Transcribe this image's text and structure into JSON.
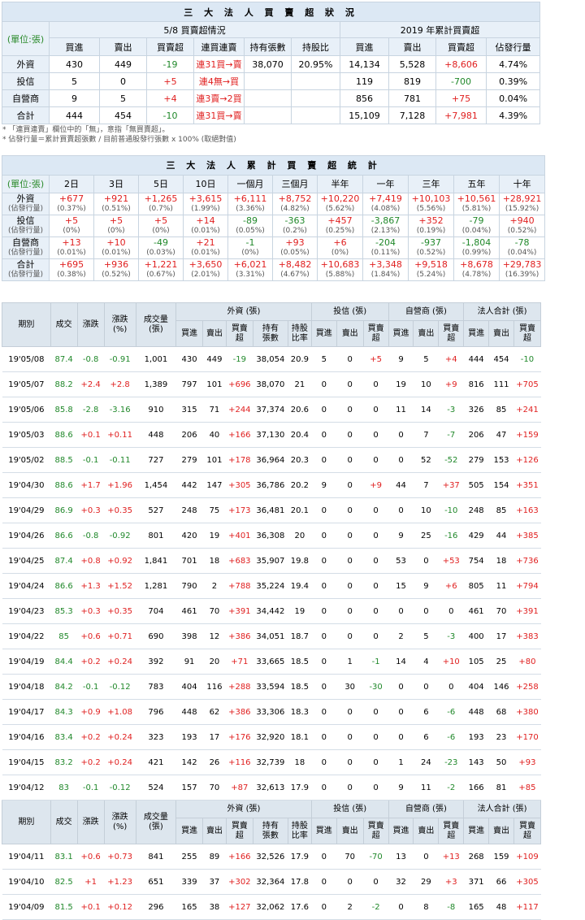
{
  "summary": {
    "title": "三 大 法 人 買 賣 超 狀 況",
    "unit": "(單位:張)",
    "daily_header": "5/8 買賣超情況",
    "ytd_header": "2019 年累計買賣超",
    "cols": [
      "買進",
      "賣出",
      "買賣超",
      "連買連賣",
      "持有張數",
      "持股比",
      "買進",
      "賣出",
      "買賣超",
      "佔發行量"
    ],
    "rows": [
      {
        "name": "外資",
        "buy": "430",
        "sell": "449",
        "net": "-19",
        "streak": "連31買→賣",
        "hold": "38,070",
        "ratio": "20.95%",
        "ybuy": "14,134",
        "ysell": "5,528",
        "ynet": "+8,606",
        "share": "4.74%"
      },
      {
        "name": "投信",
        "buy": "5",
        "sell": "0",
        "net": "+5",
        "streak": "連4無→買",
        "hold": "",
        "ratio": "",
        "ybuy": "119",
        "ysell": "819",
        "ynet": "-700",
        "share": "0.39%"
      },
      {
        "name": "自營商",
        "buy": "9",
        "sell": "5",
        "net": "+4",
        "streak": "連3賣→2買",
        "hold": "",
        "ratio": "",
        "ybuy": "856",
        "ysell": "781",
        "ynet": "+75",
        "share": "0.04%"
      },
      {
        "name": "合計",
        "buy": "444",
        "sell": "454",
        "net": "-10",
        "streak": "連31買→賣",
        "hold": "",
        "ratio": "",
        "ybuy": "15,109",
        "ysell": "7,128",
        "ynet": "+7,981",
        "share": "4.39%"
      }
    ],
    "notes": [
      "* 「連買連賣」欄位中的「無」，意指「無買賣超」。",
      "* 佔發行量＝累計買賣超張數 / 目前普通股發行張數 x 100% (取絕對值)"
    ]
  },
  "cumulative": {
    "title": "三 大 法 人 累 計 買 賣 超 統 計",
    "unit": "(單位:張)",
    "periods": [
      "2日",
      "3日",
      "5日",
      "10日",
      "一個月",
      "三個月",
      "半年",
      "一年",
      "三年",
      "五年",
      "十年"
    ],
    "sub_label": "(佔發行量)",
    "rows": [
      {
        "name": "外資",
        "vals": [
          "+677",
          "+921",
          "+1,265",
          "+3,615",
          "+6,111",
          "+8,752",
          "+10,220",
          "+7,419",
          "+10,103",
          "+10,561",
          "+28,921"
        ],
        "pcts": [
          "(0.37%)",
          "(0.51%)",
          "(0.7%)",
          "(1.99%)",
          "(3.36%)",
          "(4.82%)",
          "(5.62%)",
          "(4.08%)",
          "(5.56%)",
          "(5.81%)",
          "(15.92%)"
        ]
      },
      {
        "name": "投信",
        "vals": [
          "+5",
          "+5",
          "+5",
          "+14",
          "-89",
          "-363",
          "+457",
          "-3,867",
          "+352",
          "-79",
          "+940"
        ],
        "pcts": [
          "(0%)",
          "(0%)",
          "(0%)",
          "(0.01%)",
          "(0.05%)",
          "(0.2%)",
          "(0.25%)",
          "(2.13%)",
          "(0.19%)",
          "(0.04%)",
          "(0.52%)"
        ]
      },
      {
        "name": "自營商",
        "vals": [
          "+13",
          "+10",
          "-49",
          "+21",
          "-1",
          "+93",
          "+6",
          "-204",
          "-937",
          "-1,804",
          "-78"
        ],
        "pcts": [
          "(0.01%)",
          "(0.01%)",
          "(0.03%)",
          "(0.01%)",
          "(0%)",
          "(0.05%)",
          "(0%)",
          "(0.11%)",
          "(0.52%)",
          "(0.99%)",
          "(0.04%)"
        ]
      },
      {
        "name": "合計",
        "vals": [
          "+695",
          "+936",
          "+1,221",
          "+3,650",
          "+6,021",
          "+8,482",
          "+10,683",
          "+3,348",
          "+9,518",
          "+8,678",
          "+29,783"
        ],
        "pcts": [
          "(0.38%)",
          "(0.52%)",
          "(0.67%)",
          "(2.01%)",
          "(3.31%)",
          "(4.67%)",
          "(5.88%)",
          "(1.84%)",
          "(5.24%)",
          "(4.78%)",
          "(16.39%)"
        ]
      }
    ]
  },
  "history": {
    "headers": {
      "date": "期別",
      "close": "成交",
      "change": "漲跌",
      "pct": "漲跌\n(%)",
      "vol": "成交量\n(張)",
      "foreign": "外資 (張)",
      "trust": "投信 (張)",
      "dealer": "自營商 (張)",
      "total": "法人合計 (張)",
      "buy": "買進",
      "sell": "賣出",
      "net": "買賣\n超",
      "hold": "持有\n張數",
      "ratio": "持股\n比率"
    },
    "rows1": [
      [
        "19'05/08",
        "87.4",
        "-0.8",
        "-0.91",
        "1,001",
        "430",
        "449",
        "-19",
        "38,054",
        "20.9",
        "5",
        "0",
        "+5",
        "9",
        "5",
        "+4",
        "444",
        "454",
        "-10"
      ],
      [
        "19'05/07",
        "88.2",
        "+2.4",
        "+2.8",
        "1,389",
        "797",
        "101",
        "+696",
        "38,070",
        "21",
        "0",
        "0",
        "0",
        "19",
        "10",
        "+9",
        "816",
        "111",
        "+705"
      ],
      [
        "19'05/06",
        "85.8",
        "-2.8",
        "-3.16",
        "910",
        "315",
        "71",
        "+244",
        "37,374",
        "20.6",
        "0",
        "0",
        "0",
        "11",
        "14",
        "-3",
        "326",
        "85",
        "+241"
      ],
      [
        "19'05/03",
        "88.6",
        "+0.1",
        "+0.11",
        "448",
        "206",
        "40",
        "+166",
        "37,130",
        "20.4",
        "0",
        "0",
        "0",
        "0",
        "7",
        "-7",
        "206",
        "47",
        "+159"
      ],
      [
        "19'05/02",
        "88.5",
        "-0.1",
        "-0.11",
        "727",
        "279",
        "101",
        "+178",
        "36,964",
        "20.3",
        "0",
        "0",
        "0",
        "0",
        "52",
        "-52",
        "279",
        "153",
        "+126"
      ],
      [
        "19'04/30",
        "88.6",
        "+1.7",
        "+1.96",
        "1,454",
        "442",
        "147",
        "+305",
        "36,786",
        "20.2",
        "9",
        "0",
        "+9",
        "44",
        "7",
        "+37",
        "505",
        "154",
        "+351"
      ],
      [
        "19'04/29",
        "86.9",
        "+0.3",
        "+0.35",
        "527",
        "248",
        "75",
        "+173",
        "36,481",
        "20.1",
        "0",
        "0",
        "0",
        "0",
        "10",
        "-10",
        "248",
        "85",
        "+163"
      ],
      [
        "19'04/26",
        "86.6",
        "-0.8",
        "-0.92",
        "801",
        "420",
        "19",
        "+401",
        "36,308",
        "20",
        "0",
        "0",
        "0",
        "9",
        "25",
        "-16",
        "429",
        "44",
        "+385"
      ],
      [
        "19'04/25",
        "87.4",
        "+0.8",
        "+0.92",
        "1,841",
        "701",
        "18",
        "+683",
        "35,907",
        "19.8",
        "0",
        "0",
        "0",
        "53",
        "0",
        "+53",
        "754",
        "18",
        "+736"
      ],
      [
        "19'04/24",
        "86.6",
        "+1.3",
        "+1.52",
        "1,281",
        "790",
        "2",
        "+788",
        "35,224",
        "19.4",
        "0",
        "0",
        "0",
        "15",
        "9",
        "+6",
        "805",
        "11",
        "+794"
      ],
      [
        "19'04/23",
        "85.3",
        "+0.3",
        "+0.35",
        "704",
        "461",
        "70",
        "+391",
        "34,442",
        "19",
        "0",
        "0",
        "0",
        "0",
        "0",
        "0",
        "461",
        "70",
        "+391"
      ],
      [
        "19'04/22",
        "85",
        "+0.6",
        "+0.71",
        "690",
        "398",
        "12",
        "+386",
        "34,051",
        "18.7",
        "0",
        "0",
        "0",
        "2",
        "5",
        "-3",
        "400",
        "17",
        "+383"
      ],
      [
        "19'04/19",
        "84.4",
        "+0.2",
        "+0.24",
        "392",
        "91",
        "20",
        "+71",
        "33,665",
        "18.5",
        "0",
        "1",
        "-1",
        "14",
        "4",
        "+10",
        "105",
        "25",
        "+80"
      ],
      [
        "19'04/18",
        "84.2",
        "-0.1",
        "-0.12",
        "783",
        "404",
        "116",
        "+288",
        "33,594",
        "18.5",
        "0",
        "30",
        "-30",
        "0",
        "0",
        "0",
        "404",
        "146",
        "+258"
      ],
      [
        "19'04/17",
        "84.3",
        "+0.9",
        "+1.08",
        "796",
        "448",
        "62",
        "+386",
        "33,306",
        "18.3",
        "0",
        "0",
        "0",
        "0",
        "6",
        "-6",
        "448",
        "68",
        "+380"
      ],
      [
        "19'04/16",
        "83.4",
        "+0.2",
        "+0.24",
        "323",
        "193",
        "17",
        "+176",
        "32,920",
        "18.1",
        "0",
        "0",
        "0",
        "0",
        "6",
        "-6",
        "193",
        "23",
        "+170"
      ],
      [
        "19'04/15",
        "83.2",
        "+0.2",
        "+0.24",
        "421",
        "142",
        "26",
        "+116",
        "32,739",
        "18",
        "0",
        "0",
        "0",
        "1",
        "24",
        "-23",
        "143",
        "50",
        "+93"
      ],
      [
        "19'04/12",
        "83",
        "-0.1",
        "-0.12",
        "524",
        "157",
        "70",
        "+87",
        "32,613",
        "17.9",
        "0",
        "0",
        "0",
        "9",
        "11",
        "-2",
        "166",
        "81",
        "+85"
      ]
    ],
    "rows2": [
      [
        "19'04/11",
        "83.1",
        "+0.6",
        "+0.73",
        "841",
        "255",
        "89",
        "+166",
        "32,526",
        "17.9",
        "0",
        "70",
        "-70",
        "13",
        "0",
        "+13",
        "268",
        "159",
        "+109"
      ],
      [
        "19'04/10",
        "82.5",
        "+1",
        "+1.23",
        "651",
        "339",
        "37",
        "+302",
        "32,364",
        "17.8",
        "0",
        "0",
        "0",
        "32",
        "29",
        "+3",
        "371",
        "66",
        "+305"
      ],
      [
        "19'04/09",
        "81.5",
        "+0.1",
        "+0.12",
        "296",
        "165",
        "38",
        "+127",
        "32,062",
        "17.6",
        "0",
        "2",
        "-2",
        "0",
        "8",
        "-8",
        "165",
        "48",
        "+117"
      ]
    ]
  }
}
